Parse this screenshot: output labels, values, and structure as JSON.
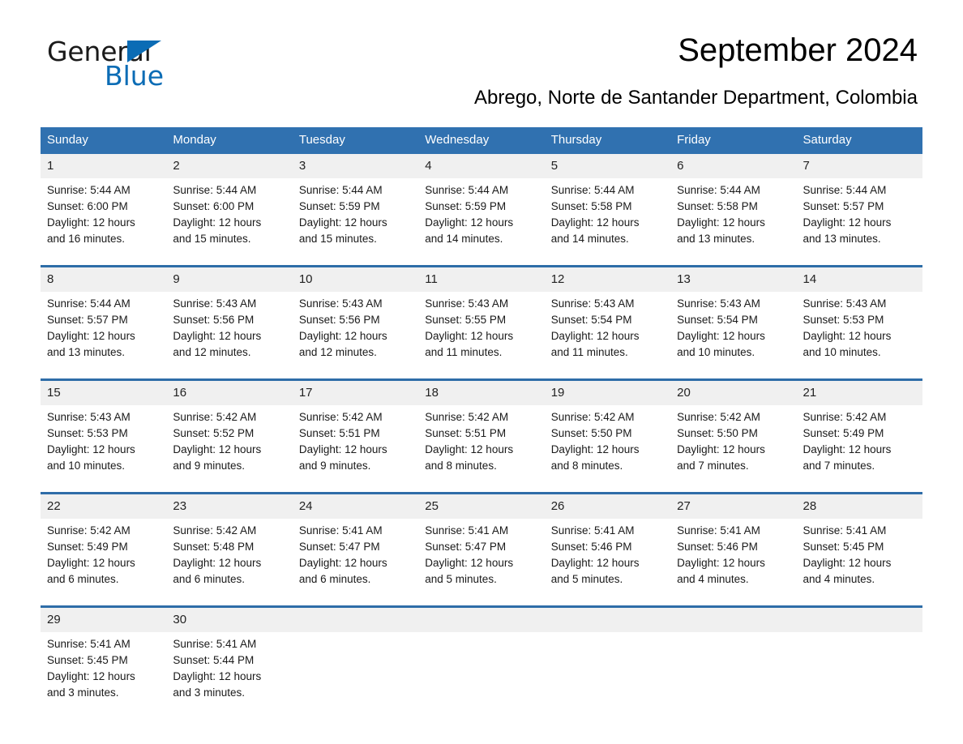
{
  "brand": {
    "name_part1": "General",
    "name_part2": "Blue",
    "accent_color": "#0b6cb5",
    "triangle_icon": "triangle-icon"
  },
  "header": {
    "title": "September 2024",
    "subtitle": "Abrego, Norte de Santander Department, Colombia"
  },
  "calendar": {
    "header_background": "#3071b0",
    "date_band_background": "#f0f0f0",
    "separator_color": "#2e6da8",
    "weekdays": [
      "Sunday",
      "Monday",
      "Tuesday",
      "Wednesday",
      "Thursday",
      "Friday",
      "Saturday"
    ],
    "weeks": [
      {
        "days": [
          {
            "date": "1",
            "sunrise": "Sunrise: 5:44 AM",
            "sunset": "Sunset: 6:00 PM",
            "daylight_line1": "Daylight: 12 hours",
            "daylight_line2": "and 16 minutes."
          },
          {
            "date": "2",
            "sunrise": "Sunrise: 5:44 AM",
            "sunset": "Sunset: 6:00 PM",
            "daylight_line1": "Daylight: 12 hours",
            "daylight_line2": "and 15 minutes."
          },
          {
            "date": "3",
            "sunrise": "Sunrise: 5:44 AM",
            "sunset": "Sunset: 5:59 PM",
            "daylight_line1": "Daylight: 12 hours",
            "daylight_line2": "and 15 minutes."
          },
          {
            "date": "4",
            "sunrise": "Sunrise: 5:44 AM",
            "sunset": "Sunset: 5:59 PM",
            "daylight_line1": "Daylight: 12 hours",
            "daylight_line2": "and 14 minutes."
          },
          {
            "date": "5",
            "sunrise": "Sunrise: 5:44 AM",
            "sunset": "Sunset: 5:58 PM",
            "daylight_line1": "Daylight: 12 hours",
            "daylight_line2": "and 14 minutes."
          },
          {
            "date": "6",
            "sunrise": "Sunrise: 5:44 AM",
            "sunset": "Sunset: 5:58 PM",
            "daylight_line1": "Daylight: 12 hours",
            "daylight_line2": "and 13 minutes."
          },
          {
            "date": "7",
            "sunrise": "Sunrise: 5:44 AM",
            "sunset": "Sunset: 5:57 PM",
            "daylight_line1": "Daylight: 12 hours",
            "daylight_line2": "and 13 minutes."
          }
        ]
      },
      {
        "days": [
          {
            "date": "8",
            "sunrise": "Sunrise: 5:44 AM",
            "sunset": "Sunset: 5:57 PM",
            "daylight_line1": "Daylight: 12 hours",
            "daylight_line2": "and 13 minutes."
          },
          {
            "date": "9",
            "sunrise": "Sunrise: 5:43 AM",
            "sunset": "Sunset: 5:56 PM",
            "daylight_line1": "Daylight: 12 hours",
            "daylight_line2": "and 12 minutes."
          },
          {
            "date": "10",
            "sunrise": "Sunrise: 5:43 AM",
            "sunset": "Sunset: 5:56 PM",
            "daylight_line1": "Daylight: 12 hours",
            "daylight_line2": "and 12 minutes."
          },
          {
            "date": "11",
            "sunrise": "Sunrise: 5:43 AM",
            "sunset": "Sunset: 5:55 PM",
            "daylight_line1": "Daylight: 12 hours",
            "daylight_line2": "and 11 minutes."
          },
          {
            "date": "12",
            "sunrise": "Sunrise: 5:43 AM",
            "sunset": "Sunset: 5:54 PM",
            "daylight_line1": "Daylight: 12 hours",
            "daylight_line2": "and 11 minutes."
          },
          {
            "date": "13",
            "sunrise": "Sunrise: 5:43 AM",
            "sunset": "Sunset: 5:54 PM",
            "daylight_line1": "Daylight: 12 hours",
            "daylight_line2": "and 10 minutes."
          },
          {
            "date": "14",
            "sunrise": "Sunrise: 5:43 AM",
            "sunset": "Sunset: 5:53 PM",
            "daylight_line1": "Daylight: 12 hours",
            "daylight_line2": "and 10 minutes."
          }
        ]
      },
      {
        "days": [
          {
            "date": "15",
            "sunrise": "Sunrise: 5:43 AM",
            "sunset": "Sunset: 5:53 PM",
            "daylight_line1": "Daylight: 12 hours",
            "daylight_line2": "and 10 minutes."
          },
          {
            "date": "16",
            "sunrise": "Sunrise: 5:42 AM",
            "sunset": "Sunset: 5:52 PM",
            "daylight_line1": "Daylight: 12 hours",
            "daylight_line2": "and 9 minutes."
          },
          {
            "date": "17",
            "sunrise": "Sunrise: 5:42 AM",
            "sunset": "Sunset: 5:51 PM",
            "daylight_line1": "Daylight: 12 hours",
            "daylight_line2": "and 9 minutes."
          },
          {
            "date": "18",
            "sunrise": "Sunrise: 5:42 AM",
            "sunset": "Sunset: 5:51 PM",
            "daylight_line1": "Daylight: 12 hours",
            "daylight_line2": "and 8 minutes."
          },
          {
            "date": "19",
            "sunrise": "Sunrise: 5:42 AM",
            "sunset": "Sunset: 5:50 PM",
            "daylight_line1": "Daylight: 12 hours",
            "daylight_line2": "and 8 minutes."
          },
          {
            "date": "20",
            "sunrise": "Sunrise: 5:42 AM",
            "sunset": "Sunset: 5:50 PM",
            "daylight_line1": "Daylight: 12 hours",
            "daylight_line2": "and 7 minutes."
          },
          {
            "date": "21",
            "sunrise": "Sunrise: 5:42 AM",
            "sunset": "Sunset: 5:49 PM",
            "daylight_line1": "Daylight: 12 hours",
            "daylight_line2": "and 7 minutes."
          }
        ]
      },
      {
        "days": [
          {
            "date": "22",
            "sunrise": "Sunrise: 5:42 AM",
            "sunset": "Sunset: 5:49 PM",
            "daylight_line1": "Daylight: 12 hours",
            "daylight_line2": "and 6 minutes."
          },
          {
            "date": "23",
            "sunrise": "Sunrise: 5:42 AM",
            "sunset": "Sunset: 5:48 PM",
            "daylight_line1": "Daylight: 12 hours",
            "daylight_line2": "and 6 minutes."
          },
          {
            "date": "24",
            "sunrise": "Sunrise: 5:41 AM",
            "sunset": "Sunset: 5:47 PM",
            "daylight_line1": "Daylight: 12 hours",
            "daylight_line2": "and 6 minutes."
          },
          {
            "date": "25",
            "sunrise": "Sunrise: 5:41 AM",
            "sunset": "Sunset: 5:47 PM",
            "daylight_line1": "Daylight: 12 hours",
            "daylight_line2": "and 5 minutes."
          },
          {
            "date": "26",
            "sunrise": "Sunrise: 5:41 AM",
            "sunset": "Sunset: 5:46 PM",
            "daylight_line1": "Daylight: 12 hours",
            "daylight_line2": "and 5 minutes."
          },
          {
            "date": "27",
            "sunrise": "Sunrise: 5:41 AM",
            "sunset": "Sunset: 5:46 PM",
            "daylight_line1": "Daylight: 12 hours",
            "daylight_line2": "and 4 minutes."
          },
          {
            "date": "28",
            "sunrise": "Sunrise: 5:41 AM",
            "sunset": "Sunset: 5:45 PM",
            "daylight_line1": "Daylight: 12 hours",
            "daylight_line2": "and 4 minutes."
          }
        ]
      },
      {
        "days": [
          {
            "date": "29",
            "sunrise": "Sunrise: 5:41 AM",
            "sunset": "Sunset: 5:45 PM",
            "daylight_line1": "Daylight: 12 hours",
            "daylight_line2": "and 3 minutes."
          },
          {
            "date": "30",
            "sunrise": "Sunrise: 5:41 AM",
            "sunset": "Sunset: 5:44 PM",
            "daylight_line1": "Daylight: 12 hours",
            "daylight_line2": "and 3 minutes."
          },
          {
            "date": "",
            "sunrise": "",
            "sunset": "",
            "daylight_line1": "",
            "daylight_line2": ""
          },
          {
            "date": "",
            "sunrise": "",
            "sunset": "",
            "daylight_line1": "",
            "daylight_line2": ""
          },
          {
            "date": "",
            "sunrise": "",
            "sunset": "",
            "daylight_line1": "",
            "daylight_line2": ""
          },
          {
            "date": "",
            "sunrise": "",
            "sunset": "",
            "daylight_line1": "",
            "daylight_line2": ""
          },
          {
            "date": "",
            "sunrise": "",
            "sunset": "",
            "daylight_line1": "",
            "daylight_line2": ""
          }
        ]
      }
    ]
  }
}
